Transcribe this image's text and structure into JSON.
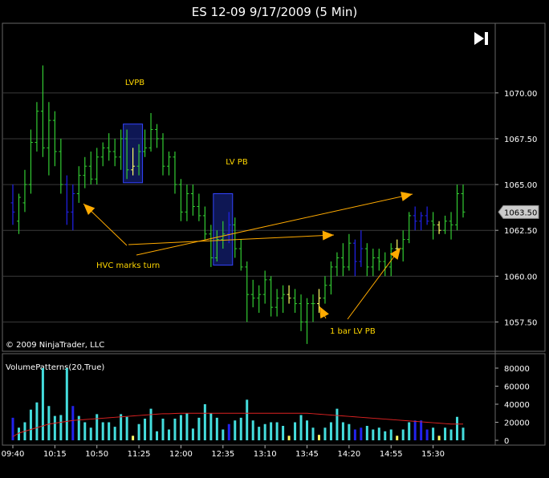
{
  "window": {
    "title": "ES 12-09  9/17/2009 (5 Min)",
    "copyright": "© 2009 NinjaTrader, LLC",
    "play_icon": "skip-forward-icon"
  },
  "price_panel": {
    "ylim": [
      1055.9,
      1073.8
    ],
    "ticks": [
      "1070.00",
      "1067.50",
      "1065.00",
      "1062.50",
      "1060.00",
      "1057.50"
    ],
    "tick_values": [
      1070.0,
      1067.5,
      1065.0,
      1062.5,
      1060.0,
      1057.5
    ],
    "last_price": "1063.50",
    "last_price_value": 1063.5
  },
  "volume_panel": {
    "label": "VolumePatterns(20,True)",
    "ylim": [
      0,
      96000
    ],
    "ticks": [
      "80000",
      "60000",
      "40000",
      "20000",
      "0"
    ],
    "tick_values": [
      80000,
      60000,
      40000,
      20000,
      0
    ]
  },
  "time_axis": {
    "labels": [
      "09:40",
      "10:15",
      "10:50",
      "11:25",
      "12:00",
      "12:35",
      "13:10",
      "13:45",
      "14:20",
      "14:55",
      "15:30"
    ],
    "label_bar_index": [
      0,
      7,
      14,
      21,
      28,
      35,
      42,
      49,
      56,
      63,
      70
    ]
  },
  "annotations": {
    "lvpb": "LVPB",
    "lv_pb": "LV PB",
    "hvc": "HVC marks turn",
    "one_bar": "1 bar LV PB"
  },
  "colors": {
    "background": "#000000",
    "up_bar": "#33cc33",
    "down_bar": "#2222ee",
    "low_volume_bar": "#ffff66",
    "volume_normal": "#44dddd",
    "volume_high": "#2222ee",
    "volume_low": "#ffff66",
    "volume_average": "#dd2222",
    "annotation": "#ffd700",
    "arrow": "#ffaa00",
    "grid": "#3a3a3a"
  },
  "chart_data": {
    "type": "ohlc",
    "title": "ES 12-09  9/17/2009 (5 Min)",
    "bars": [
      {
        "o": 1064.0,
        "h": 1065.0,
        "l": 1062.8,
        "c": 1063.5,
        "k": "d"
      },
      {
        "o": 1063.0,
        "h": 1064.5,
        "l": 1062.3,
        "c": 1064.3,
        "k": "u"
      },
      {
        "o": 1064.0,
        "h": 1065.8,
        "l": 1063.5,
        "c": 1065.0,
        "k": "u"
      },
      {
        "o": 1065.0,
        "h": 1068.0,
        "l": 1064.5,
        "c": 1067.3,
        "k": "u"
      },
      {
        "o": 1067.3,
        "h": 1069.5,
        "l": 1066.8,
        "c": 1069.0,
        "k": "u"
      },
      {
        "o": 1069.0,
        "h": 1071.5,
        "l": 1066.5,
        "c": 1067.0,
        "k": "u"
      },
      {
        "o": 1067.0,
        "h": 1069.5,
        "l": 1065.5,
        "c": 1068.5,
        "k": "u"
      },
      {
        "o": 1068.5,
        "h": 1069.0,
        "l": 1066.0,
        "c": 1066.8,
        "k": "u"
      },
      {
        "o": 1066.8,
        "h": 1067.5,
        "l": 1064.5,
        "c": 1065.0,
        "k": "u"
      },
      {
        "o": 1065.0,
        "h": 1065.5,
        "l": 1062.8,
        "c": 1063.5,
        "k": "d"
      },
      {
        "o": 1063.5,
        "h": 1065.0,
        "l": 1062.5,
        "c": 1064.5,
        "k": "d"
      },
      {
        "o": 1064.5,
        "h": 1066.0,
        "l": 1064.0,
        "c": 1065.5,
        "k": "u"
      },
      {
        "o": 1065.5,
        "h": 1066.5,
        "l": 1064.8,
        "c": 1066.0,
        "k": "u"
      },
      {
        "o": 1066.0,
        "h": 1066.8,
        "l": 1065.0,
        "c": 1065.3,
        "k": "u"
      },
      {
        "o": 1065.3,
        "h": 1067.0,
        "l": 1065.0,
        "c": 1066.5,
        "k": "u"
      },
      {
        "o": 1066.5,
        "h": 1067.3,
        "l": 1066.0,
        "c": 1067.0,
        "k": "u"
      },
      {
        "o": 1067.0,
        "h": 1067.8,
        "l": 1066.3,
        "c": 1066.8,
        "k": "u"
      },
      {
        "o": 1066.8,
        "h": 1067.5,
        "l": 1066.0,
        "c": 1066.5,
        "k": "u"
      },
      {
        "o": 1066.5,
        "h": 1068.0,
        "l": 1065.8,
        "c": 1067.5,
        "k": "u"
      },
      {
        "o": 1067.5,
        "h": 1068.0,
        "l": 1065.3,
        "c": 1065.8,
        "k": "u"
      },
      {
        "o": 1065.8,
        "h": 1067.0,
        "l": 1065.5,
        "c": 1066.0,
        "k": "l"
      },
      {
        "o": 1066.0,
        "h": 1067.2,
        "l": 1065.5,
        "c": 1066.8,
        "k": "u"
      },
      {
        "o": 1066.8,
        "h": 1068.0,
        "l": 1066.5,
        "c": 1067.0,
        "k": "u"
      },
      {
        "o": 1067.0,
        "h": 1068.9,
        "l": 1066.8,
        "c": 1068.0,
        "k": "u"
      },
      {
        "o": 1068.0,
        "h": 1068.3,
        "l": 1067.0,
        "c": 1067.5,
        "k": "u"
      },
      {
        "o": 1067.5,
        "h": 1067.8,
        "l": 1065.5,
        "c": 1066.0,
        "k": "u"
      },
      {
        "o": 1066.0,
        "h": 1066.8,
        "l": 1065.5,
        "c": 1066.5,
        "k": "u"
      },
      {
        "o": 1066.5,
        "h": 1066.8,
        "l": 1064.5,
        "c": 1065.0,
        "k": "u"
      },
      {
        "o": 1065.0,
        "h": 1065.3,
        "l": 1063.0,
        "c": 1063.5,
        "k": "u"
      },
      {
        "o": 1063.5,
        "h": 1065.0,
        "l": 1063.0,
        "c": 1064.5,
        "k": "u"
      },
      {
        "o": 1064.5,
        "h": 1065.0,
        "l": 1063.3,
        "c": 1063.8,
        "k": "u"
      },
      {
        "o": 1063.8,
        "h": 1064.5,
        "l": 1063.0,
        "c": 1063.3,
        "k": "u"
      },
      {
        "o": 1063.3,
        "h": 1063.8,
        "l": 1062.0,
        "c": 1062.3,
        "k": "u"
      },
      {
        "o": 1062.3,
        "h": 1062.8,
        "l": 1060.5,
        "c": 1061.0,
        "k": "u"
      },
      {
        "o": 1061.0,
        "h": 1062.5,
        "l": 1060.8,
        "c": 1062.0,
        "k": "u"
      },
      {
        "o": 1062.0,
        "h": 1063.0,
        "l": 1061.5,
        "c": 1062.3,
        "k": "u"
      },
      {
        "o": 1062.3,
        "h": 1063.5,
        "l": 1061.8,
        "c": 1062.8,
        "k": "d"
      },
      {
        "o": 1062.8,
        "h": 1063.2,
        "l": 1061.0,
        "c": 1061.5,
        "k": "u"
      },
      {
        "o": 1061.5,
        "h": 1062.0,
        "l": 1060.3,
        "c": 1060.5,
        "k": "u"
      },
      {
        "o": 1060.5,
        "h": 1060.8,
        "l": 1057.5,
        "c": 1059.0,
        "k": "u"
      },
      {
        "o": 1059.0,
        "h": 1059.8,
        "l": 1058.3,
        "c": 1058.8,
        "k": "u"
      },
      {
        "o": 1058.8,
        "h": 1059.5,
        "l": 1058.0,
        "c": 1059.0,
        "k": "u"
      },
      {
        "o": 1059.0,
        "h": 1060.3,
        "l": 1058.5,
        "c": 1059.8,
        "k": "u"
      },
      {
        "o": 1059.8,
        "h": 1060.0,
        "l": 1057.8,
        "c": 1058.3,
        "k": "u"
      },
      {
        "o": 1058.3,
        "h": 1059.3,
        "l": 1057.8,
        "c": 1058.8,
        "k": "u"
      },
      {
        "o": 1058.8,
        "h": 1059.5,
        "l": 1058.0,
        "c": 1059.0,
        "k": "u"
      },
      {
        "o": 1059.0,
        "h": 1059.5,
        "l": 1058.5,
        "c": 1058.8,
        "k": "l"
      },
      {
        "o": 1058.8,
        "h": 1059.3,
        "l": 1058.0,
        "c": 1058.5,
        "k": "u"
      },
      {
        "o": 1058.5,
        "h": 1059.0,
        "l": 1057.0,
        "c": 1057.5,
        "k": "u"
      },
      {
        "o": 1057.5,
        "h": 1058.8,
        "l": 1056.3,
        "c": 1058.5,
        "k": "u"
      },
      {
        "o": 1058.5,
        "h": 1059.0,
        "l": 1057.5,
        "c": 1058.5,
        "k": "u"
      },
      {
        "o": 1058.5,
        "h": 1059.3,
        "l": 1058.0,
        "c": 1058.8,
        "k": "l"
      },
      {
        "o": 1058.8,
        "h": 1060.0,
        "l": 1058.5,
        "c": 1059.5,
        "k": "u"
      },
      {
        "o": 1059.5,
        "h": 1060.8,
        "l": 1059.0,
        "c": 1060.5,
        "k": "u"
      },
      {
        "o": 1060.5,
        "h": 1061.3,
        "l": 1060.0,
        "c": 1061.0,
        "k": "u"
      },
      {
        "o": 1061.0,
        "h": 1061.8,
        "l": 1060.0,
        "c": 1060.5,
        "k": "u"
      },
      {
        "o": 1060.5,
        "h": 1062.3,
        "l": 1060.3,
        "c": 1061.8,
        "k": "u"
      },
      {
        "o": 1061.8,
        "h": 1062.0,
        "l": 1060.0,
        "c": 1060.8,
        "k": "d"
      },
      {
        "o": 1060.8,
        "h": 1062.5,
        "l": 1060.5,
        "c": 1061.5,
        "k": "d"
      },
      {
        "o": 1061.5,
        "h": 1061.8,
        "l": 1060.0,
        "c": 1060.5,
        "k": "u"
      },
      {
        "o": 1060.5,
        "h": 1061.5,
        "l": 1060.0,
        "c": 1061.0,
        "k": "u"
      },
      {
        "o": 1061.0,
        "h": 1061.5,
        "l": 1060.3,
        "c": 1060.8,
        "k": "u"
      },
      {
        "o": 1060.8,
        "h": 1061.3,
        "l": 1060.0,
        "c": 1060.5,
        "k": "u"
      },
      {
        "o": 1060.5,
        "h": 1061.8,
        "l": 1060.0,
        "c": 1061.5,
        "k": "u"
      },
      {
        "o": 1061.5,
        "h": 1062.0,
        "l": 1061.0,
        "c": 1061.5,
        "k": "l"
      },
      {
        "o": 1061.5,
        "h": 1062.5,
        "l": 1060.8,
        "c": 1062.0,
        "k": "u"
      },
      {
        "o": 1062.0,
        "h": 1063.5,
        "l": 1061.8,
        "c": 1063.3,
        "k": "u"
      },
      {
        "o": 1063.3,
        "h": 1063.8,
        "l": 1062.5,
        "c": 1063.0,
        "k": "d"
      },
      {
        "o": 1063.0,
        "h": 1063.5,
        "l": 1062.5,
        "c": 1063.3,
        "k": "d"
      },
      {
        "o": 1063.3,
        "h": 1063.8,
        "l": 1062.8,
        "c": 1063.0,
        "k": "d"
      },
      {
        "o": 1063.0,
        "h": 1063.5,
        "l": 1062.0,
        "c": 1062.8,
        "k": "u"
      },
      {
        "o": 1062.8,
        "h": 1063.0,
        "l": 1062.3,
        "c": 1062.5,
        "k": "l"
      },
      {
        "o": 1062.5,
        "h": 1063.3,
        "l": 1062.3,
        "c": 1063.0,
        "k": "u"
      },
      {
        "o": 1063.0,
        "h": 1063.5,
        "l": 1062.0,
        "c": 1062.8,
        "k": "u"
      },
      {
        "o": 1062.8,
        "h": 1065.0,
        "l": 1062.5,
        "c": 1064.5,
        "k": "u"
      },
      {
        "o": 1064.5,
        "h": 1065.0,
        "l": 1063.2,
        "c": 1063.5,
        "k": "u"
      }
    ],
    "volume": [
      {
        "v": 25000,
        "k": "h"
      },
      {
        "v": 14000,
        "k": "n"
      },
      {
        "v": 20000,
        "k": "n"
      },
      {
        "v": 34000,
        "k": "n"
      },
      {
        "v": 42000,
        "k": "n"
      },
      {
        "v": 80000,
        "k": "n"
      },
      {
        "v": 38000,
        "k": "n"
      },
      {
        "v": 27000,
        "k": "n"
      },
      {
        "v": 28000,
        "k": "n"
      },
      {
        "v": 80000,
        "k": "n"
      },
      {
        "v": 38000,
        "k": "h"
      },
      {
        "v": 27000,
        "k": "n"
      },
      {
        "v": 20000,
        "k": "n"
      },
      {
        "v": 14000,
        "k": "n"
      },
      {
        "v": 29000,
        "k": "n"
      },
      {
        "v": 20000,
        "k": "n"
      },
      {
        "v": 20000,
        "k": "n"
      },
      {
        "v": 15000,
        "k": "n"
      },
      {
        "v": 29000,
        "k": "n"
      },
      {
        "v": 26000,
        "k": "n"
      },
      {
        "v": 5000,
        "k": "l"
      },
      {
        "v": 18000,
        "k": "n"
      },
      {
        "v": 24000,
        "k": "n"
      },
      {
        "v": 35000,
        "k": "n"
      },
      {
        "v": 10000,
        "k": "n"
      },
      {
        "v": 24000,
        "k": "n"
      },
      {
        "v": 12000,
        "k": "n"
      },
      {
        "v": 24000,
        "k": "n"
      },
      {
        "v": 28000,
        "k": "n"
      },
      {
        "v": 30000,
        "k": "n"
      },
      {
        "v": 13000,
        "k": "n"
      },
      {
        "v": 25000,
        "k": "n"
      },
      {
        "v": 40000,
        "k": "n"
      },
      {
        "v": 30000,
        "k": "n"
      },
      {
        "v": 25000,
        "k": "n"
      },
      {
        "v": 12000,
        "k": "n"
      },
      {
        "v": 18000,
        "k": "h"
      },
      {
        "v": 22000,
        "k": "n"
      },
      {
        "v": 25000,
        "k": "n"
      },
      {
        "v": 45000,
        "k": "n"
      },
      {
        "v": 22000,
        "k": "n"
      },
      {
        "v": 15000,
        "k": "n"
      },
      {
        "v": 18000,
        "k": "n"
      },
      {
        "v": 20000,
        "k": "n"
      },
      {
        "v": 20000,
        "k": "n"
      },
      {
        "v": 16000,
        "k": "n"
      },
      {
        "v": 5000,
        "k": "l"
      },
      {
        "v": 20000,
        "k": "n"
      },
      {
        "v": 28000,
        "k": "n"
      },
      {
        "v": 22000,
        "k": "n"
      },
      {
        "v": 14000,
        "k": "n"
      },
      {
        "v": 6000,
        "k": "l"
      },
      {
        "v": 14000,
        "k": "n"
      },
      {
        "v": 20000,
        "k": "n"
      },
      {
        "v": 35000,
        "k": "n"
      },
      {
        "v": 20000,
        "k": "n"
      },
      {
        "v": 18000,
        "k": "n"
      },
      {
        "v": 12000,
        "k": "h"
      },
      {
        "v": 14000,
        "k": "h"
      },
      {
        "v": 16000,
        "k": "n"
      },
      {
        "v": 12000,
        "k": "n"
      },
      {
        "v": 14000,
        "k": "n"
      },
      {
        "v": 10000,
        "k": "n"
      },
      {
        "v": 12000,
        "k": "n"
      },
      {
        "v": 5000,
        "k": "l"
      },
      {
        "v": 12000,
        "k": "n"
      },
      {
        "v": 20000,
        "k": "n"
      },
      {
        "v": 22000,
        "k": "h"
      },
      {
        "v": 22000,
        "k": "h"
      },
      {
        "v": 12000,
        "k": "h"
      },
      {
        "v": 14000,
        "k": "n"
      },
      {
        "v": 5000,
        "k": "l"
      },
      {
        "v": 14000,
        "k": "n"
      },
      {
        "v": 12000,
        "k": "n"
      },
      {
        "v": 26000,
        "k": "n"
      },
      {
        "v": 14000,
        "k": "n"
      }
    ],
    "volume_average": [
      4000,
      8000,
      10000,
      12000,
      14000,
      16000,
      18000,
      19000,
      20000,
      21000,
      22000,
      22500,
      23000,
      23500,
      24000,
      24500,
      25000,
      25500,
      26000,
      26500,
      27000,
      27500,
      28000,
      28500,
      29000,
      29500,
      29500,
      29800,
      30000,
      30000,
      30000,
      30000,
      30000,
      30000,
      30000,
      30000,
      30000,
      30000,
      30000,
      30000,
      30000,
      30000,
      30000,
      30000,
      30000,
      30000,
      30000,
      30000,
      30000,
      30000,
      29500,
      29000,
      28500,
      28000,
      27500,
      27000,
      26500,
      26000,
      25500,
      25000,
      24500,
      24000,
      23500,
      23000,
      22500,
      22000,
      21500,
      21000,
      20500,
      20000,
      19500,
      19000,
      18500,
      18000,
      18000,
      18000
    ],
    "boxes": [
      {
        "label": "LVPB",
        "from_bar": 19,
        "to_bar": 21,
        "top": 1068.3,
        "bottom": 1065.1
      },
      {
        "label": "LV PB",
        "from_bar": 34,
        "to_bar": 36,
        "top": 1064.5,
        "bottom": 1060.6
      }
    ]
  }
}
